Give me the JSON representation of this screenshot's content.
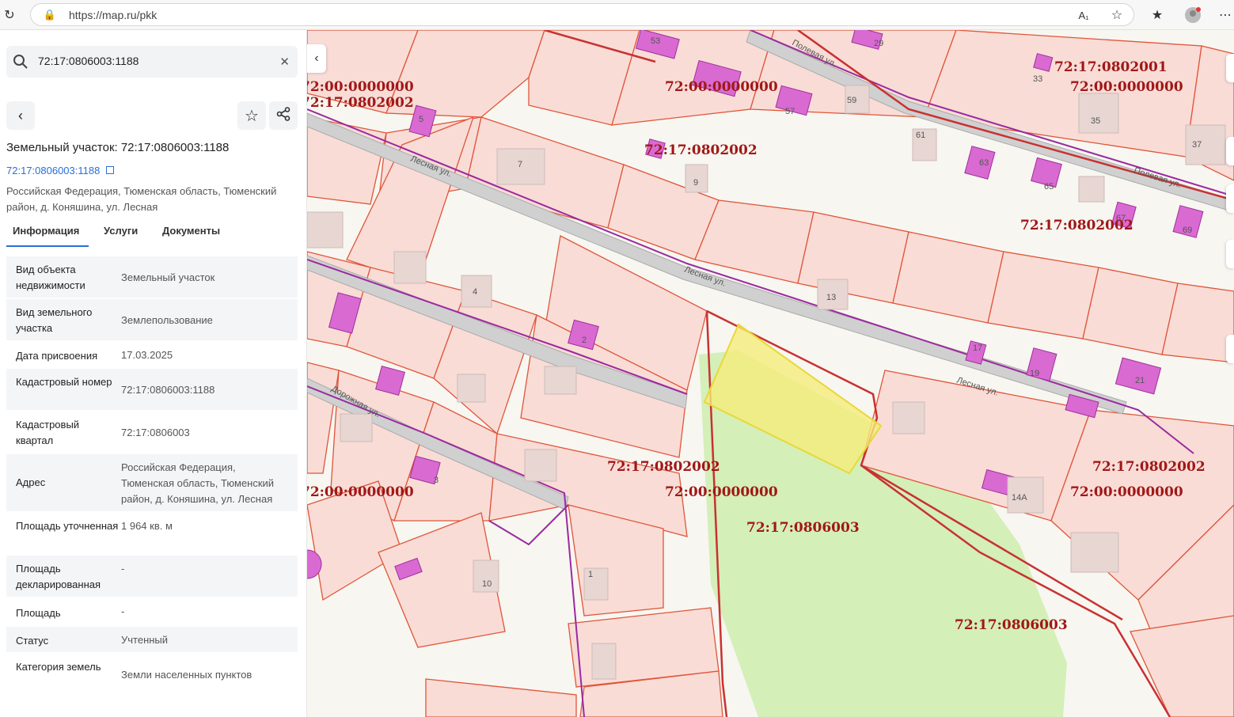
{
  "browser": {
    "url": "https://map.ru/pkk"
  },
  "search": {
    "value": "72:17:0806003:1188"
  },
  "object": {
    "title": "Земельный участок: 72:17:0806003:1188",
    "cad_number_link": "72:17:0806003:1188",
    "address": "Российская Федерация, Тюменская область, Тюменский район, д. Коняшина, ул. Лесная"
  },
  "tabs": [
    {
      "label": "Информация"
    },
    {
      "label": "Услуги"
    },
    {
      "label": "Документы"
    }
  ],
  "info": [
    {
      "key": "Вид объекта недвижимости",
      "value": "Земельный участок"
    },
    {
      "key": "Вид земельного участка",
      "value": "Землепользование"
    },
    {
      "key": "Дата присвоения",
      "value": "17.03.2025"
    },
    {
      "key": "Кадастровый номер",
      "value": "72:17:0806003:1188"
    },
    {
      "key": "Кадастровый квартал",
      "value": "72:17:0806003"
    },
    {
      "key": "Адрес",
      "value": "Российская Федерация, Тюменская область, Тюменский район, д. Коняшина, ул. Лесная"
    },
    {
      "key": "Площадь уточненная",
      "value": "1 964 кв. м"
    },
    {
      "key": "Площадь декларированная",
      "value": "-"
    },
    {
      "key": "Площадь",
      "value": "-"
    },
    {
      "key": "Статус",
      "value": "Учтенный"
    },
    {
      "key": "Категория земель",
      "value": "Земли населенных пунктов"
    }
  ],
  "map": {
    "quarter_labels": [
      "72:17:0802002",
      "72:00:0000000",
      "72:17:0802001",
      "72:17:0806003"
    ],
    "streets": [
      "Лесная ул.",
      "Полевая ул.",
      "Дорожная ул."
    ],
    "house_numbers": [
      "53",
      "29",
      "33",
      "5",
      "57",
      "59",
      "35",
      "7",
      "61",
      "37",
      "9",
      "63",
      "65",
      "67",
      "69",
      "4",
      "13",
      "2",
      "17",
      "19",
      "21",
      "3",
      "14А",
      "1",
      "10"
    ],
    "colors": {
      "parcel_border": "#e0553a",
      "parcel_fill": "#f9dcd6",
      "building": "#d96ad2",
      "selected": "#f5ec7a",
      "forest": "#d4efb8",
      "quarter_border": "#c83232",
      "road": "#cfcfcf"
    }
  }
}
